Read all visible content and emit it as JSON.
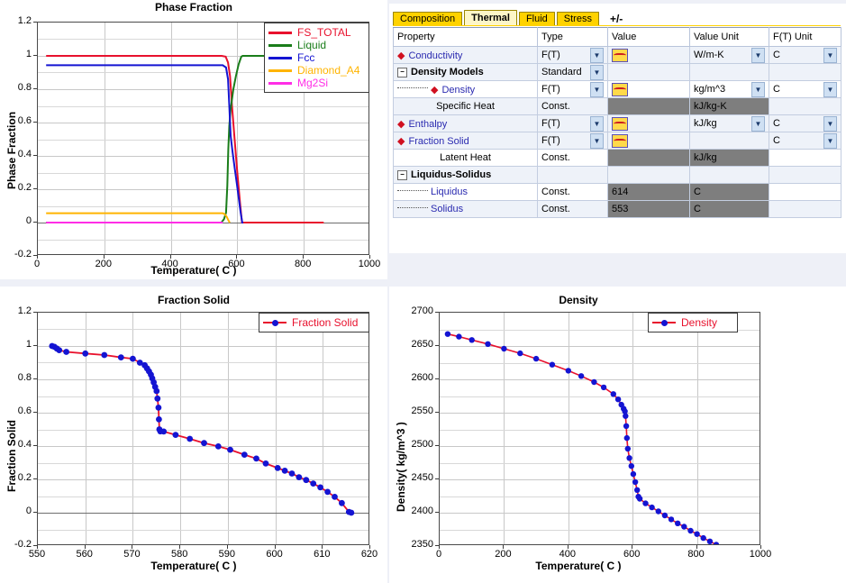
{
  "app": {
    "background": "#eef0f7",
    "accent_tab": "#ffd200"
  },
  "property_grid": {
    "tabs": [
      {
        "label": "Composition",
        "active": false
      },
      {
        "label": "Thermal",
        "active": true
      },
      {
        "label": "Fluid",
        "active": false
      },
      {
        "label": "Stress",
        "active": false
      },
      {
        "label": "+/-",
        "active": false
      }
    ],
    "columns": [
      "Property",
      "Type",
      "Value",
      "Value Unit",
      "F(T) Unit"
    ],
    "rows": [
      {
        "property": "Conductivity",
        "indent": 1,
        "bullet": true,
        "link": true,
        "bold": false,
        "type": "F(T)",
        "type_dd": true,
        "value": "",
        "value_icon": true,
        "value_disabled": false,
        "vunit": "W/m-K",
        "vunit_dd": true,
        "vunit_disabled": false,
        "ftunit": "C",
        "ftunit_dd": true,
        "stripe": "alt"
      },
      {
        "property": "Density Models",
        "indent": 0,
        "bullet": false,
        "link": false,
        "bold": true,
        "tree": "minus",
        "type": "Standard",
        "type_dd": true,
        "value": "",
        "value_icon": false,
        "value_disabled": false,
        "vunit": "",
        "vunit_dd": false,
        "vunit_disabled": false,
        "ftunit": "",
        "ftunit_dd": false,
        "stripe": "alt"
      },
      {
        "property": "Density",
        "indent": 2,
        "bullet": true,
        "link": true,
        "bold": false,
        "lead": true,
        "type": "F(T)",
        "type_dd": true,
        "value": "",
        "value_icon": true,
        "value_disabled": false,
        "vunit": "kg/m^3",
        "vunit_dd": true,
        "vunit_disabled": false,
        "ftunit": "C",
        "ftunit_dd": true,
        "stripe": "plain"
      },
      {
        "property": "Specific Heat",
        "indent": 1,
        "bullet": false,
        "link": false,
        "bold": false,
        "center": true,
        "type": "Const.",
        "type_dd": false,
        "value": "",
        "value_icon": false,
        "value_disabled": true,
        "vunit": "kJ/kg-K",
        "vunit_dd": false,
        "vunit_disabled": true,
        "ftunit": "",
        "ftunit_dd": false,
        "stripe": "alt"
      },
      {
        "property": "Enthalpy",
        "indent": 1,
        "bullet": true,
        "link": true,
        "bold": false,
        "type": "F(T)",
        "type_dd": true,
        "value": "",
        "value_icon": true,
        "value_disabled": false,
        "vunit": "kJ/kg",
        "vunit_dd": true,
        "vunit_disabled": false,
        "ftunit": "C",
        "ftunit_dd": true,
        "stripe": "alt"
      },
      {
        "property": "Fraction Solid",
        "indent": 1,
        "bullet": true,
        "link": true,
        "bold": false,
        "type": "F(T)",
        "type_dd": true,
        "value": "",
        "value_icon": true,
        "value_disabled": false,
        "vunit": "",
        "vunit_dd": false,
        "vunit_disabled": false,
        "ftunit": "C",
        "ftunit_dd": true,
        "stripe": "alt"
      },
      {
        "property": "Latent Heat",
        "indent": 1,
        "bullet": false,
        "link": false,
        "bold": false,
        "center": true,
        "type": "Const.",
        "type_dd": false,
        "value": "",
        "value_icon": false,
        "value_disabled": true,
        "vunit": "kJ/kg",
        "vunit_dd": false,
        "vunit_disabled": true,
        "ftunit": "",
        "ftunit_dd": false,
        "stripe": "plain"
      },
      {
        "property": "Liquidus-Solidus",
        "indent": 0,
        "bullet": false,
        "link": false,
        "bold": true,
        "tree": "minus",
        "type": "",
        "type_dd": false,
        "value": "",
        "value_icon": false,
        "value_disabled": false,
        "vunit": "",
        "vunit_dd": false,
        "vunit_disabled": false,
        "ftunit": "",
        "ftunit_dd": false,
        "stripe": "alt"
      },
      {
        "property": "Liquidus",
        "indent": 2,
        "bullet": false,
        "link": true,
        "bold": false,
        "lead": true,
        "type": "Const.",
        "type_dd": false,
        "value": "614",
        "value_icon": false,
        "value_disabled": true,
        "vunit": "C",
        "vunit_dd": false,
        "vunit_disabled": true,
        "ftunit": "",
        "ftunit_dd": false,
        "stripe": "plain"
      },
      {
        "property": "Solidus",
        "indent": 2,
        "bullet": false,
        "link": true,
        "bold": false,
        "lead": true,
        "type": "Const.",
        "type_dd": false,
        "value": "553",
        "value_icon": false,
        "value_disabled": true,
        "vunit": "C",
        "vunit_dd": false,
        "vunit_disabled": true,
        "ftunit": "",
        "ftunit_dd": false,
        "stripe": "alt"
      }
    ]
  },
  "chart_data": [
    {
      "id": "phase_fraction",
      "type": "line",
      "title": "Phase Fraction",
      "xlabel": "Temperature( C )",
      "ylabel": "Phase Fraction",
      "xlim": [
        0,
        1000
      ],
      "ylim": [
        -0.2,
        1.2
      ],
      "xticks": [
        0,
        200,
        400,
        600,
        800,
        1000
      ],
      "yticks": [
        -0.2,
        0,
        0.2,
        0.4,
        0.6,
        0.8,
        1,
        1.2
      ],
      "ytick_labels": [
        "-0.2",
        "0",
        "0.2",
        "0.4",
        "0.6",
        "0.8",
        "1",
        "1.2"
      ],
      "grid": true,
      "legend_position": "top-right",
      "series": [
        {
          "name": "FS_TOTAL",
          "color": "#e8112d",
          "points": [
            [
              25,
              1.0
            ],
            [
              400,
              1.0
            ],
            [
              540,
              1.0
            ],
            [
              553,
              1.0
            ],
            [
              565,
              0.995
            ],
            [
              572,
              0.96
            ],
            [
              578,
              0.88
            ],
            [
              584,
              0.7
            ],
            [
              592,
              0.5
            ],
            [
              600,
              0.3
            ],
            [
              608,
              0.12
            ],
            [
              614,
              0.0
            ],
            [
              620,
              0.0
            ],
            [
              700,
              0.0
            ],
            [
              860,
              0.0
            ]
          ]
        },
        {
          "name": "Liquid",
          "color": "#1a7d1a",
          "points": [
            [
              25,
              0.0
            ],
            [
              540,
              0.0
            ],
            [
              552,
              0.0
            ],
            [
              560,
              0.02
            ],
            [
              566,
              0.06
            ],
            [
              570,
              0.22
            ],
            [
              573,
              0.44
            ],
            [
              576,
              0.58
            ],
            [
              580,
              0.68
            ],
            [
              588,
              0.8
            ],
            [
              596,
              0.88
            ],
            [
              604,
              0.95
            ],
            [
              612,
              0.995
            ],
            [
              616,
              1.0
            ],
            [
              700,
              1.0
            ],
            [
              860,
              1.0
            ]
          ]
        },
        {
          "name": "Fcc",
          "color": "#1414d2",
          "points": [
            [
              25,
              0.944
            ],
            [
              400,
              0.944
            ],
            [
              540,
              0.944
            ],
            [
              556,
              0.944
            ],
            [
              566,
              0.93
            ],
            [
              572,
              0.86
            ],
            [
              576,
              0.7
            ],
            [
              580,
              0.52
            ],
            [
              586,
              0.42
            ],
            [
              592,
              0.33
            ],
            [
              598,
              0.24
            ],
            [
              604,
              0.15
            ],
            [
              610,
              0.06
            ],
            [
              615,
              0.0
            ],
            [
              618,
              0.0
            ]
          ]
        },
        {
          "name": "Diamond_A4",
          "color": "#ffb400",
          "points": [
            [
              25,
              0.056
            ],
            [
              400,
              0.056
            ],
            [
              540,
              0.056
            ],
            [
              556,
              0.056
            ],
            [
              562,
              0.05
            ],
            [
              568,
              0.035
            ],
            [
              572,
              0.018
            ],
            [
              576,
              0.004
            ],
            [
              578,
              0.0
            ]
          ]
        },
        {
          "name": "Mg2Si",
          "color": "#ff2ee6",
          "points": [
            [
              25,
              0.0
            ],
            [
              300,
              0.0
            ],
            [
              500,
              0.0
            ],
            [
              550,
              0.0
            ],
            [
              556,
              0.0
            ]
          ]
        }
      ]
    },
    {
      "id": "fraction_solid",
      "type": "line",
      "title": "Fraction Solid",
      "xlabel": "Temperature( C )",
      "ylabel": "Fraction Solid",
      "xlim": [
        550,
        620
      ],
      "ylim": [
        -0.2,
        1.2
      ],
      "xticks": [
        550,
        560,
        570,
        580,
        590,
        600,
        610,
        620
      ],
      "yticks": [
        -0.2,
        0,
        0.2,
        0.4,
        0.6,
        0.8,
        1,
        1.2
      ],
      "ytick_labels": [
        "-0.2",
        "0",
        "0.2",
        "0.4",
        "0.6",
        "0.8",
        "1",
        "1.2"
      ],
      "grid": true,
      "legend_position": "top-right",
      "legend_label": "Fraction Solid",
      "line_color": "#e8112d",
      "marker_color": "#1414d2",
      "series": [
        {
          "name": "Fraction Solid",
          "color": "#e8112d",
          "points": [
            [
              553.0,
              1.0
            ],
            [
              553.5,
              0.995
            ],
            [
              554.0,
              0.985
            ],
            [
              554.5,
              0.975
            ],
            [
              556.0,
              0.965
            ],
            [
              560.0,
              0.955
            ],
            [
              564.0,
              0.946
            ],
            [
              567.5,
              0.932
            ],
            [
              570.0,
              0.924
            ],
            [
              571.5,
              0.9
            ],
            [
              572.5,
              0.885
            ],
            [
              573.0,
              0.866
            ],
            [
              573.4,
              0.848
            ],
            [
              573.8,
              0.828
            ],
            [
              574.1,
              0.806
            ],
            [
              574.4,
              0.782
            ],
            [
              574.7,
              0.755
            ],
            [
              575.0,
              0.73
            ],
            [
              575.2,
              0.685
            ],
            [
              575.4,
              0.63
            ],
            [
              575.5,
              0.56
            ],
            [
              575.6,
              0.5
            ],
            [
              575.8,
              0.488
            ],
            [
              576.5,
              0.487
            ],
            [
              579.0,
              0.467
            ],
            [
              582.0,
              0.443
            ],
            [
              585.0,
              0.418
            ],
            [
              588.0,
              0.398
            ],
            [
              590.5,
              0.378
            ],
            [
              593.5,
              0.348
            ],
            [
              596.0,
              0.325
            ],
            [
              598.0,
              0.295
            ],
            [
              600.5,
              0.268
            ],
            [
              602.0,
              0.252
            ],
            [
              603.5,
              0.235
            ],
            [
              605.0,
              0.213
            ],
            [
              606.5,
              0.196
            ],
            [
              608.0,
              0.175
            ],
            [
              609.5,
              0.152
            ],
            [
              611.0,
              0.125
            ],
            [
              612.5,
              0.095
            ],
            [
              614.0,
              0.058
            ],
            [
              615.5,
              0.005
            ],
            [
              616.0,
              0.0
            ]
          ]
        }
      ]
    },
    {
      "id": "density",
      "type": "line",
      "title": "Density",
      "xlabel": "Temperature( C )",
      "ylabel": "Density( kg/m^3 )",
      "xlim": [
        0,
        1000
      ],
      "ylim": [
        2350,
        2700
      ],
      "xticks": [
        0,
        200,
        400,
        600,
        800,
        1000
      ],
      "yticks": [
        2350,
        2400,
        2450,
        2500,
        2550,
        2600,
        2650,
        2700
      ],
      "ytick_labels": [
        "2350",
        "2400",
        "2450",
        "2500",
        "2550",
        "2600",
        "2650",
        "2700"
      ],
      "grid": true,
      "legend_position": "top-right",
      "legend_label": "Density",
      "line_color": "#e8112d",
      "marker_color": "#1414d2",
      "series": [
        {
          "name": "Density",
          "color": "#e8112d",
          "points": [
            [
              25,
              2668
            ],
            [
              60,
              2664
            ],
            [
              100,
              2659
            ],
            [
              150,
              2653
            ],
            [
              200,
              2646
            ],
            [
              250,
              2639
            ],
            [
              300,
              2631
            ],
            [
              350,
              2622
            ],
            [
              400,
              2613
            ],
            [
              440,
              2605
            ],
            [
              480,
              2596
            ],
            [
              510,
              2588
            ],
            [
              540,
              2578
            ],
            [
              555,
              2570
            ],
            [
              565,
              2562
            ],
            [
              572,
              2556
            ],
            [
              576,
              2552
            ],
            [
              578,
              2545
            ],
            [
              580,
              2530
            ],
            [
              582,
              2512
            ],
            [
              585,
              2496
            ],
            [
              590,
              2482
            ],
            [
              596,
              2470
            ],
            [
              602,
              2458
            ],
            [
              608,
              2446
            ],
            [
              614,
              2434
            ],
            [
              618,
              2424
            ],
            [
              622,
              2421
            ],
            [
              640,
              2414
            ],
            [
              660,
              2408
            ],
            [
              680,
              2402
            ],
            [
              700,
              2396
            ],
            [
              720,
              2390
            ],
            [
              740,
              2384
            ],
            [
              760,
              2379
            ],
            [
              780,
              2373
            ],
            [
              800,
              2368
            ],
            [
              820,
              2362
            ],
            [
              840,
              2357
            ],
            [
              860,
              2352
            ]
          ]
        }
      ]
    }
  ]
}
